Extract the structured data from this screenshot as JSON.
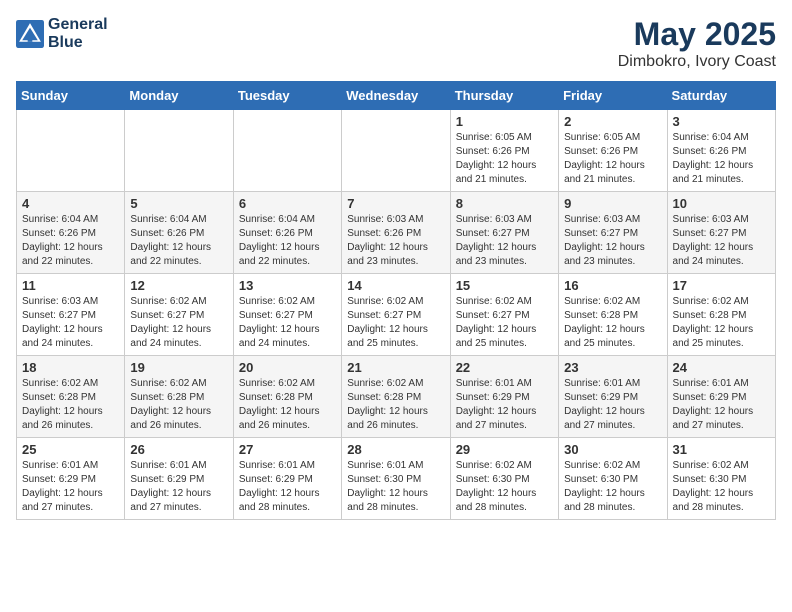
{
  "logo": {
    "line1": "General",
    "line2": "Blue"
  },
  "title": "May 2025",
  "subtitle": "Dimbokro, Ivory Coast",
  "days_of_week": [
    "Sunday",
    "Monday",
    "Tuesday",
    "Wednesday",
    "Thursday",
    "Friday",
    "Saturday"
  ],
  "weeks": [
    [
      {
        "day": "",
        "info": ""
      },
      {
        "day": "",
        "info": ""
      },
      {
        "day": "",
        "info": ""
      },
      {
        "day": "",
        "info": ""
      },
      {
        "day": "1",
        "info": "Sunrise: 6:05 AM\nSunset: 6:26 PM\nDaylight: 12 hours and 21 minutes."
      },
      {
        "day": "2",
        "info": "Sunrise: 6:05 AM\nSunset: 6:26 PM\nDaylight: 12 hours and 21 minutes."
      },
      {
        "day": "3",
        "info": "Sunrise: 6:04 AM\nSunset: 6:26 PM\nDaylight: 12 hours and 21 minutes."
      }
    ],
    [
      {
        "day": "4",
        "info": "Sunrise: 6:04 AM\nSunset: 6:26 PM\nDaylight: 12 hours and 22 minutes."
      },
      {
        "day": "5",
        "info": "Sunrise: 6:04 AM\nSunset: 6:26 PM\nDaylight: 12 hours and 22 minutes."
      },
      {
        "day": "6",
        "info": "Sunrise: 6:04 AM\nSunset: 6:26 PM\nDaylight: 12 hours and 22 minutes."
      },
      {
        "day": "7",
        "info": "Sunrise: 6:03 AM\nSunset: 6:26 PM\nDaylight: 12 hours and 23 minutes."
      },
      {
        "day": "8",
        "info": "Sunrise: 6:03 AM\nSunset: 6:27 PM\nDaylight: 12 hours and 23 minutes."
      },
      {
        "day": "9",
        "info": "Sunrise: 6:03 AM\nSunset: 6:27 PM\nDaylight: 12 hours and 23 minutes."
      },
      {
        "day": "10",
        "info": "Sunrise: 6:03 AM\nSunset: 6:27 PM\nDaylight: 12 hours and 24 minutes."
      }
    ],
    [
      {
        "day": "11",
        "info": "Sunrise: 6:03 AM\nSunset: 6:27 PM\nDaylight: 12 hours and 24 minutes."
      },
      {
        "day": "12",
        "info": "Sunrise: 6:02 AM\nSunset: 6:27 PM\nDaylight: 12 hours and 24 minutes."
      },
      {
        "day": "13",
        "info": "Sunrise: 6:02 AM\nSunset: 6:27 PM\nDaylight: 12 hours and 24 minutes."
      },
      {
        "day": "14",
        "info": "Sunrise: 6:02 AM\nSunset: 6:27 PM\nDaylight: 12 hours and 25 minutes."
      },
      {
        "day": "15",
        "info": "Sunrise: 6:02 AM\nSunset: 6:27 PM\nDaylight: 12 hours and 25 minutes."
      },
      {
        "day": "16",
        "info": "Sunrise: 6:02 AM\nSunset: 6:28 PM\nDaylight: 12 hours and 25 minutes."
      },
      {
        "day": "17",
        "info": "Sunrise: 6:02 AM\nSunset: 6:28 PM\nDaylight: 12 hours and 25 minutes."
      }
    ],
    [
      {
        "day": "18",
        "info": "Sunrise: 6:02 AM\nSunset: 6:28 PM\nDaylight: 12 hours and 26 minutes."
      },
      {
        "day": "19",
        "info": "Sunrise: 6:02 AM\nSunset: 6:28 PM\nDaylight: 12 hours and 26 minutes."
      },
      {
        "day": "20",
        "info": "Sunrise: 6:02 AM\nSunset: 6:28 PM\nDaylight: 12 hours and 26 minutes."
      },
      {
        "day": "21",
        "info": "Sunrise: 6:02 AM\nSunset: 6:28 PM\nDaylight: 12 hours and 26 minutes."
      },
      {
        "day": "22",
        "info": "Sunrise: 6:01 AM\nSunset: 6:29 PM\nDaylight: 12 hours and 27 minutes."
      },
      {
        "day": "23",
        "info": "Sunrise: 6:01 AM\nSunset: 6:29 PM\nDaylight: 12 hours and 27 minutes."
      },
      {
        "day": "24",
        "info": "Sunrise: 6:01 AM\nSunset: 6:29 PM\nDaylight: 12 hours and 27 minutes."
      }
    ],
    [
      {
        "day": "25",
        "info": "Sunrise: 6:01 AM\nSunset: 6:29 PM\nDaylight: 12 hours and 27 minutes."
      },
      {
        "day": "26",
        "info": "Sunrise: 6:01 AM\nSunset: 6:29 PM\nDaylight: 12 hours and 27 minutes."
      },
      {
        "day": "27",
        "info": "Sunrise: 6:01 AM\nSunset: 6:29 PM\nDaylight: 12 hours and 28 minutes."
      },
      {
        "day": "28",
        "info": "Sunrise: 6:01 AM\nSunset: 6:30 PM\nDaylight: 12 hours and 28 minutes."
      },
      {
        "day": "29",
        "info": "Sunrise: 6:02 AM\nSunset: 6:30 PM\nDaylight: 12 hours and 28 minutes."
      },
      {
        "day": "30",
        "info": "Sunrise: 6:02 AM\nSunset: 6:30 PM\nDaylight: 12 hours and 28 minutes."
      },
      {
        "day": "31",
        "info": "Sunrise: 6:02 AM\nSunset: 6:30 PM\nDaylight: 12 hours and 28 minutes."
      }
    ]
  ]
}
